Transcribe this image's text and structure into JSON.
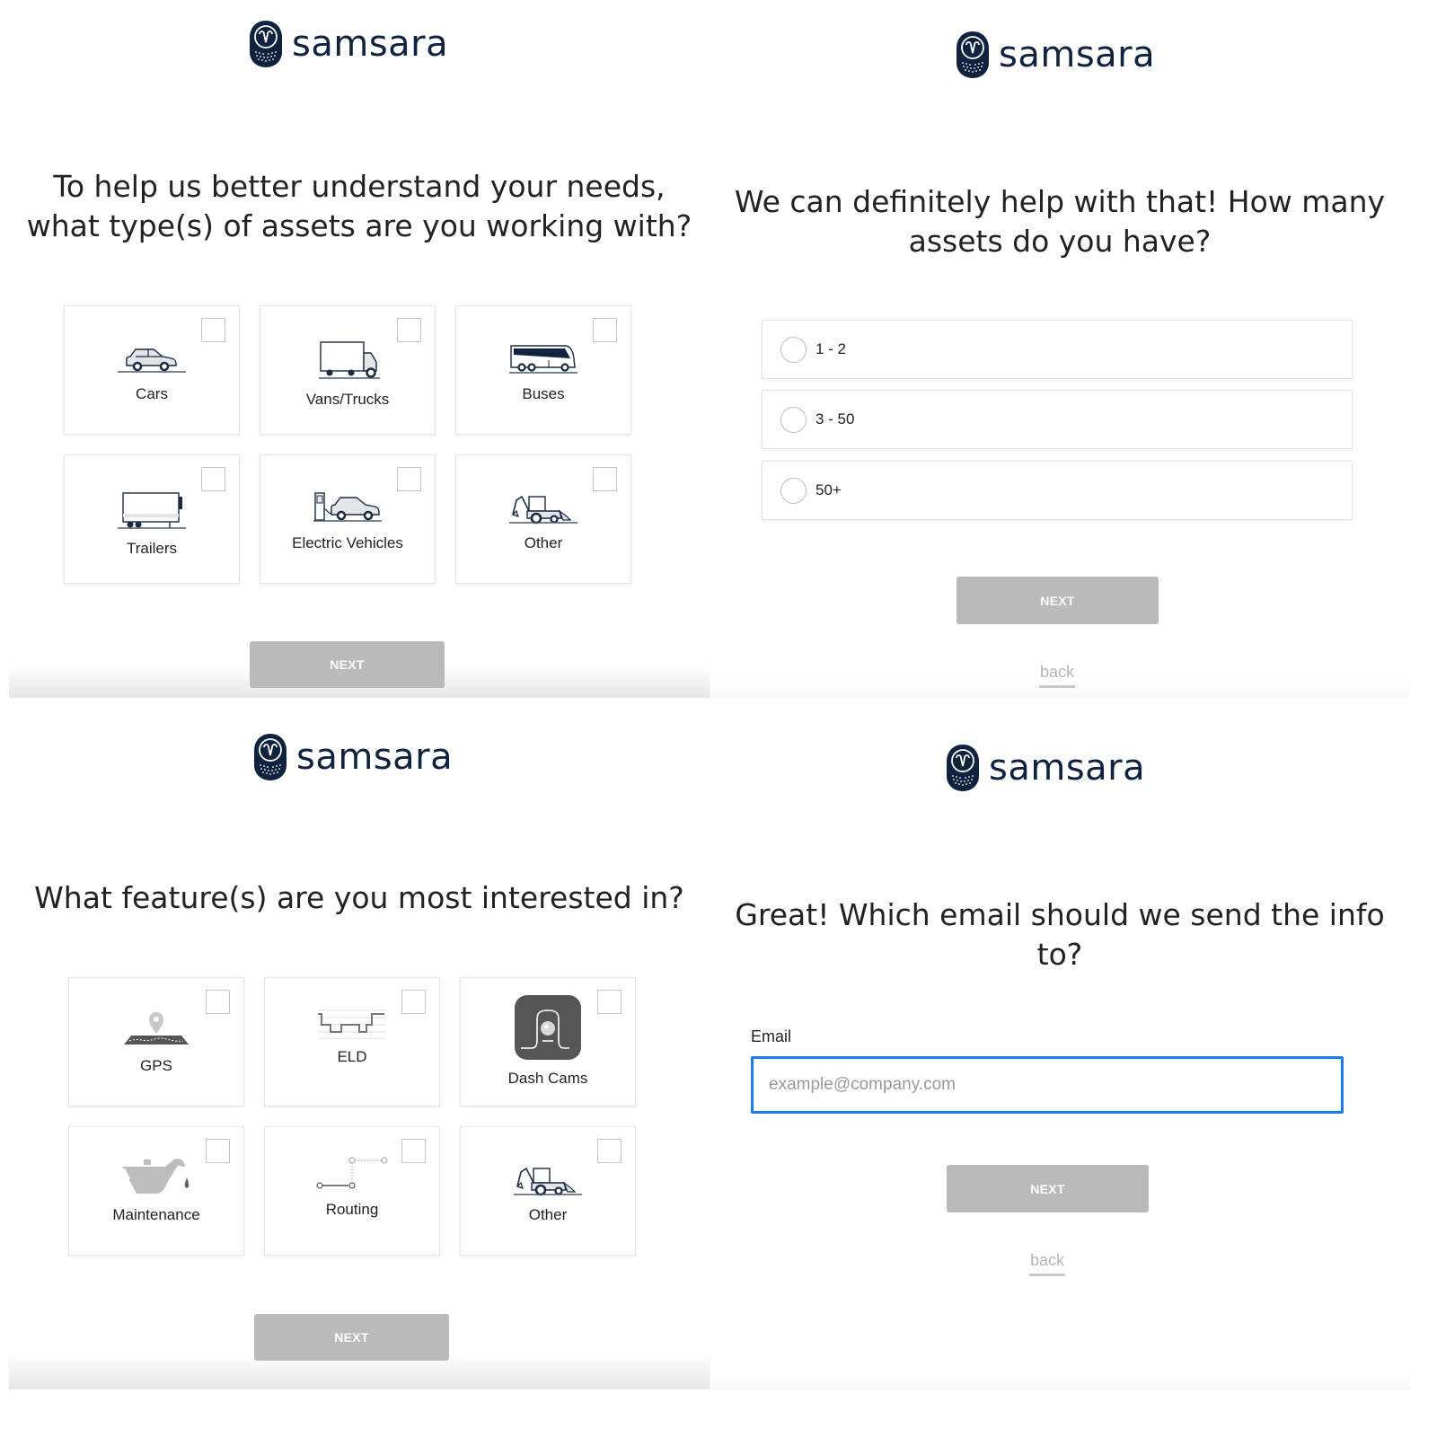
{
  "brand": {
    "name": "samsara",
    "logo_icon": "owl-logo-icon",
    "color": "#0f2340"
  },
  "colors": {
    "next_button_bg": "#bababa",
    "focus_border": "#1a7cf0",
    "back_link": "#b5b5b5"
  },
  "step_assets": {
    "heading": "To help us better understand your needs, what type(s) of assets are you working with?",
    "options": [
      {
        "label": "Cars",
        "icon": "car-icon",
        "checked": false
      },
      {
        "label": "Vans/Trucks",
        "icon": "truck-icon",
        "checked": false
      },
      {
        "label": "Buses",
        "icon": "bus-icon",
        "checked": false
      },
      {
        "label": "Trailers",
        "icon": "trailer-icon",
        "checked": false
      },
      {
        "label": "Electric Vehicles",
        "icon": "ev-charging-icon",
        "checked": false
      },
      {
        "label": "Other",
        "icon": "backhoe-icon",
        "checked": false
      }
    ],
    "next_label": "NEXT"
  },
  "step_count": {
    "heading": "We can definitely help with that! How many assets do you have?",
    "options": [
      {
        "label": "1 - 2",
        "selected": false
      },
      {
        "label": "3 - 50",
        "selected": false
      },
      {
        "label": "50+",
        "selected": false
      }
    ],
    "next_label": "NEXT",
    "back_label": "back"
  },
  "step_features": {
    "heading": "What feature(s) are you most interested in?",
    "options": [
      {
        "label": "GPS",
        "icon": "map-pin-icon",
        "checked": false
      },
      {
        "label": "ELD",
        "icon": "eld-log-icon",
        "checked": false
      },
      {
        "label": "Dash Cams",
        "icon": "dash-cam-icon",
        "checked": false
      },
      {
        "label": "Maintenance",
        "icon": "oil-can-icon",
        "checked": false
      },
      {
        "label": "Routing",
        "icon": "route-icon",
        "checked": false
      },
      {
        "label": "Other",
        "icon": "backhoe-icon",
        "checked": false
      }
    ],
    "next_label": "NEXT"
  },
  "step_email": {
    "heading": "Great! Which email should we send the info to?",
    "email_label": "Email",
    "email_value": "",
    "email_placeholder": "example@company.com",
    "next_label": "NEXT",
    "back_label": "back"
  }
}
